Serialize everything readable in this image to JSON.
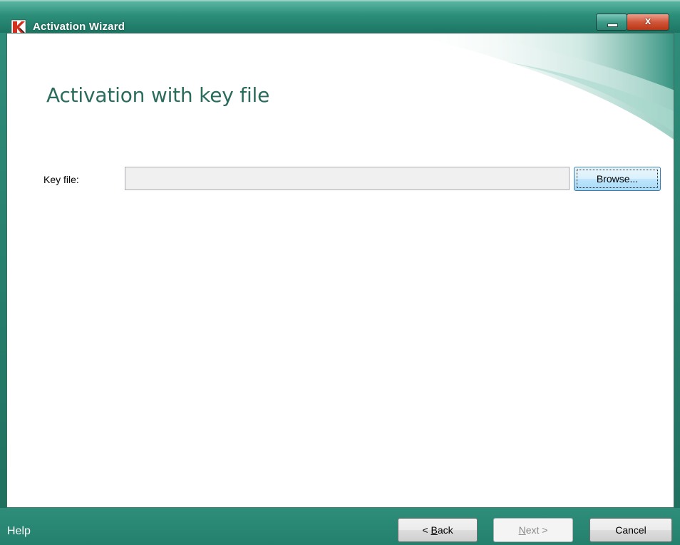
{
  "window": {
    "title": "Activation Wizard",
    "close_glyph": "x"
  },
  "icons": {
    "app": "kaspersky-logo-icon",
    "minimize": "minimize-icon",
    "close": "close-icon"
  },
  "page": {
    "title": "Activation with key file"
  },
  "form": {
    "key_file_label": "Key file:",
    "key_file_value": "",
    "browse_label": "Browse..."
  },
  "footer": {
    "help_label": "Help",
    "back_prefix": "< ",
    "back_access": "B",
    "back_rest": "ack",
    "next_access": "N",
    "next_rest": "ext >",
    "cancel_label": "Cancel",
    "next_enabled": false
  },
  "colors": {
    "accent": "#2a8f7a",
    "title_text": "#2a6c5c",
    "close_button": "#c9472a"
  }
}
